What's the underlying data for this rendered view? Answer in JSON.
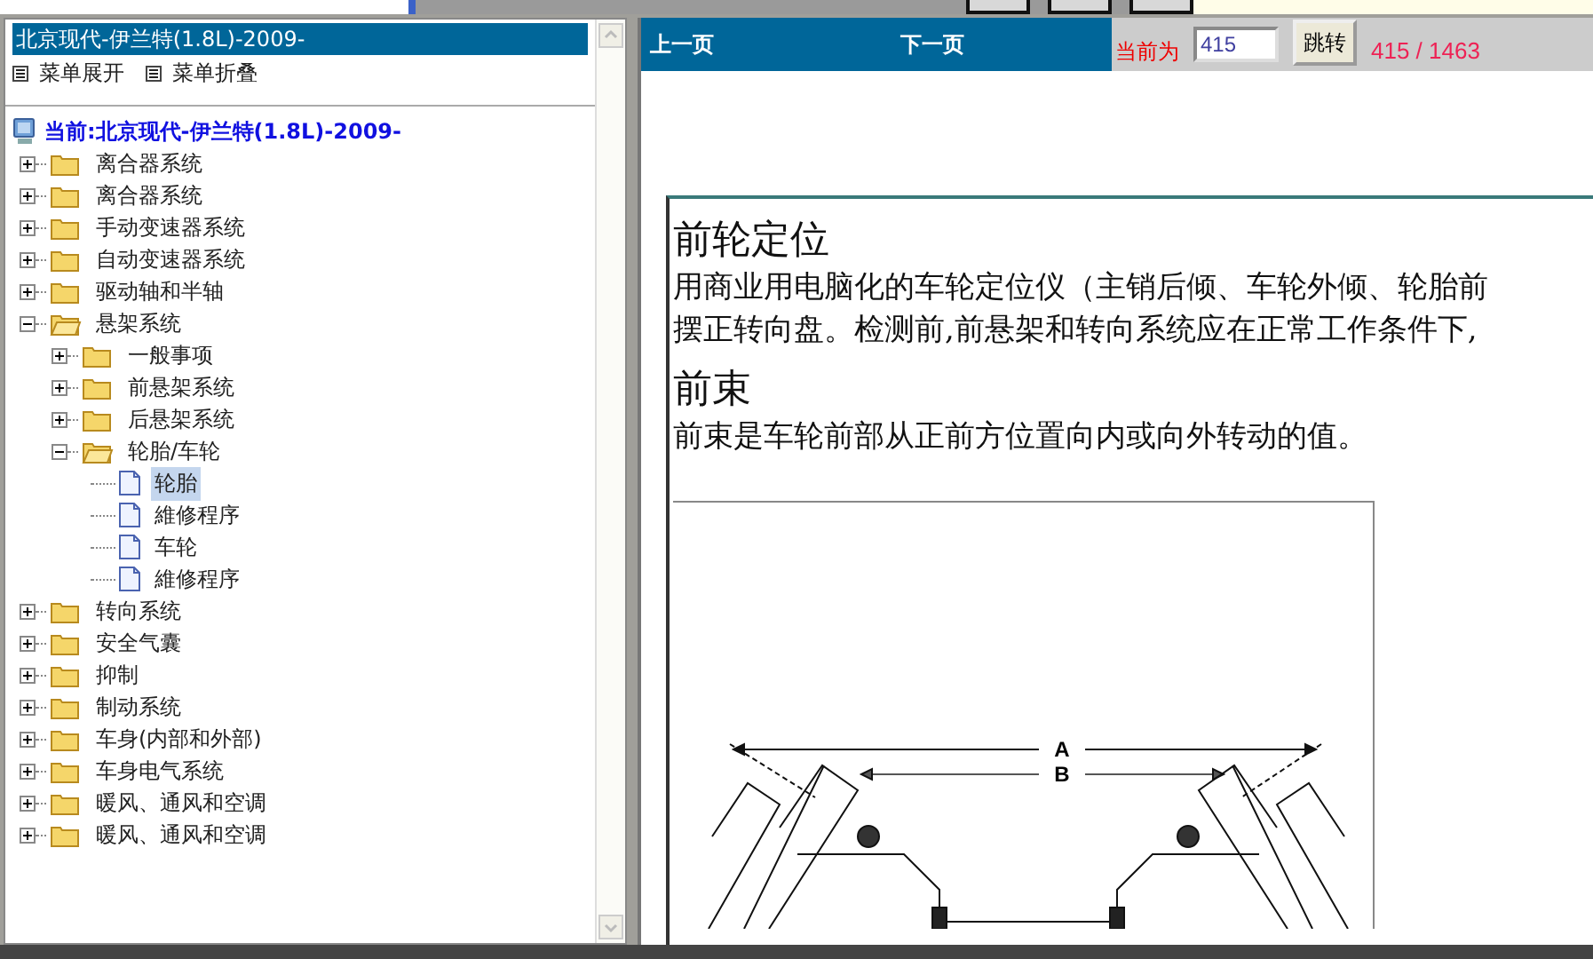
{
  "sidebar": {
    "title": "北京现代-伊兰特(1.8L)-2009-",
    "menu_actions": [
      {
        "label": "菜单展开"
      },
      {
        "label": "菜单折叠"
      }
    ],
    "root": "当前:北京现代-伊兰特(1.8L)-2009-",
    "tree": [
      {
        "label": "离合器系统",
        "kind": "folder",
        "expanded": false,
        "selected": false
      },
      {
        "label": "离合器系统",
        "kind": "folder",
        "expanded": false,
        "selected": false
      },
      {
        "label": "手动变速器系统",
        "kind": "folder",
        "expanded": false,
        "selected": false
      },
      {
        "label": "自动变速器系统",
        "kind": "folder",
        "expanded": false,
        "selected": false
      },
      {
        "label": "驱动轴和半轴",
        "kind": "folder",
        "expanded": false,
        "selected": false
      },
      {
        "label": "悬架系统",
        "kind": "folder",
        "expanded": true,
        "selected": false,
        "children": [
          {
            "label": "一般事项",
            "kind": "folder",
            "expanded": false,
            "selected": false
          },
          {
            "label": "前悬架系统",
            "kind": "folder",
            "expanded": false,
            "selected": false
          },
          {
            "label": "后悬架系统",
            "kind": "folder",
            "expanded": false,
            "selected": false
          },
          {
            "label": "轮胎/车轮",
            "kind": "folder",
            "expanded": true,
            "selected": false,
            "children": [
              {
                "label": "轮胎",
                "kind": "page",
                "selected": true
              },
              {
                "label": "維修程序",
                "kind": "page",
                "selected": false
              },
              {
                "label": "车轮",
                "kind": "page",
                "selected": false
              },
              {
                "label": "維修程序",
                "kind": "page",
                "selected": false
              }
            ]
          }
        ]
      },
      {
        "label": "转向系统",
        "kind": "folder",
        "expanded": false,
        "selected": false
      },
      {
        "label": "安全气囊",
        "kind": "folder",
        "expanded": false,
        "selected": false
      },
      {
        "label": "抑制",
        "kind": "folder",
        "expanded": false,
        "selected": false
      },
      {
        "label": "制动系统",
        "kind": "folder",
        "expanded": false,
        "selected": false
      },
      {
        "label": "车身(内部和外部)",
        "kind": "folder",
        "expanded": false,
        "selected": false
      },
      {
        "label": "车身电气系统",
        "kind": "folder",
        "expanded": false,
        "selected": false
      },
      {
        "label": "暖风、通风和空调",
        "kind": "folder",
        "expanded": false,
        "selected": false
      },
      {
        "label": "暖风、通风和空调",
        "kind": "folder",
        "expanded": false,
        "selected": false
      }
    ]
  },
  "pager": {
    "prev": "上一页",
    "next": "下一页",
    "current_label": "当前为",
    "page_input": "415",
    "go_button": "跳转",
    "page_count": "415 / 1463"
  },
  "document": {
    "sections": [
      {
        "heading": "前轮定位",
        "lines": [
          "用商业用电脑化的车轮定位仪（主销后倾、车轮外倾、轮胎前",
          "摆正转向盘。检测前,前悬架和转向系统应在正常工作条件下,"
        ]
      },
      {
        "heading": "前束",
        "lines": [
          "前束是车轮前部从正前方位置向内或向外转动的值。"
        ]
      }
    ],
    "figure_labels": [
      "A",
      "B"
    ]
  }
}
